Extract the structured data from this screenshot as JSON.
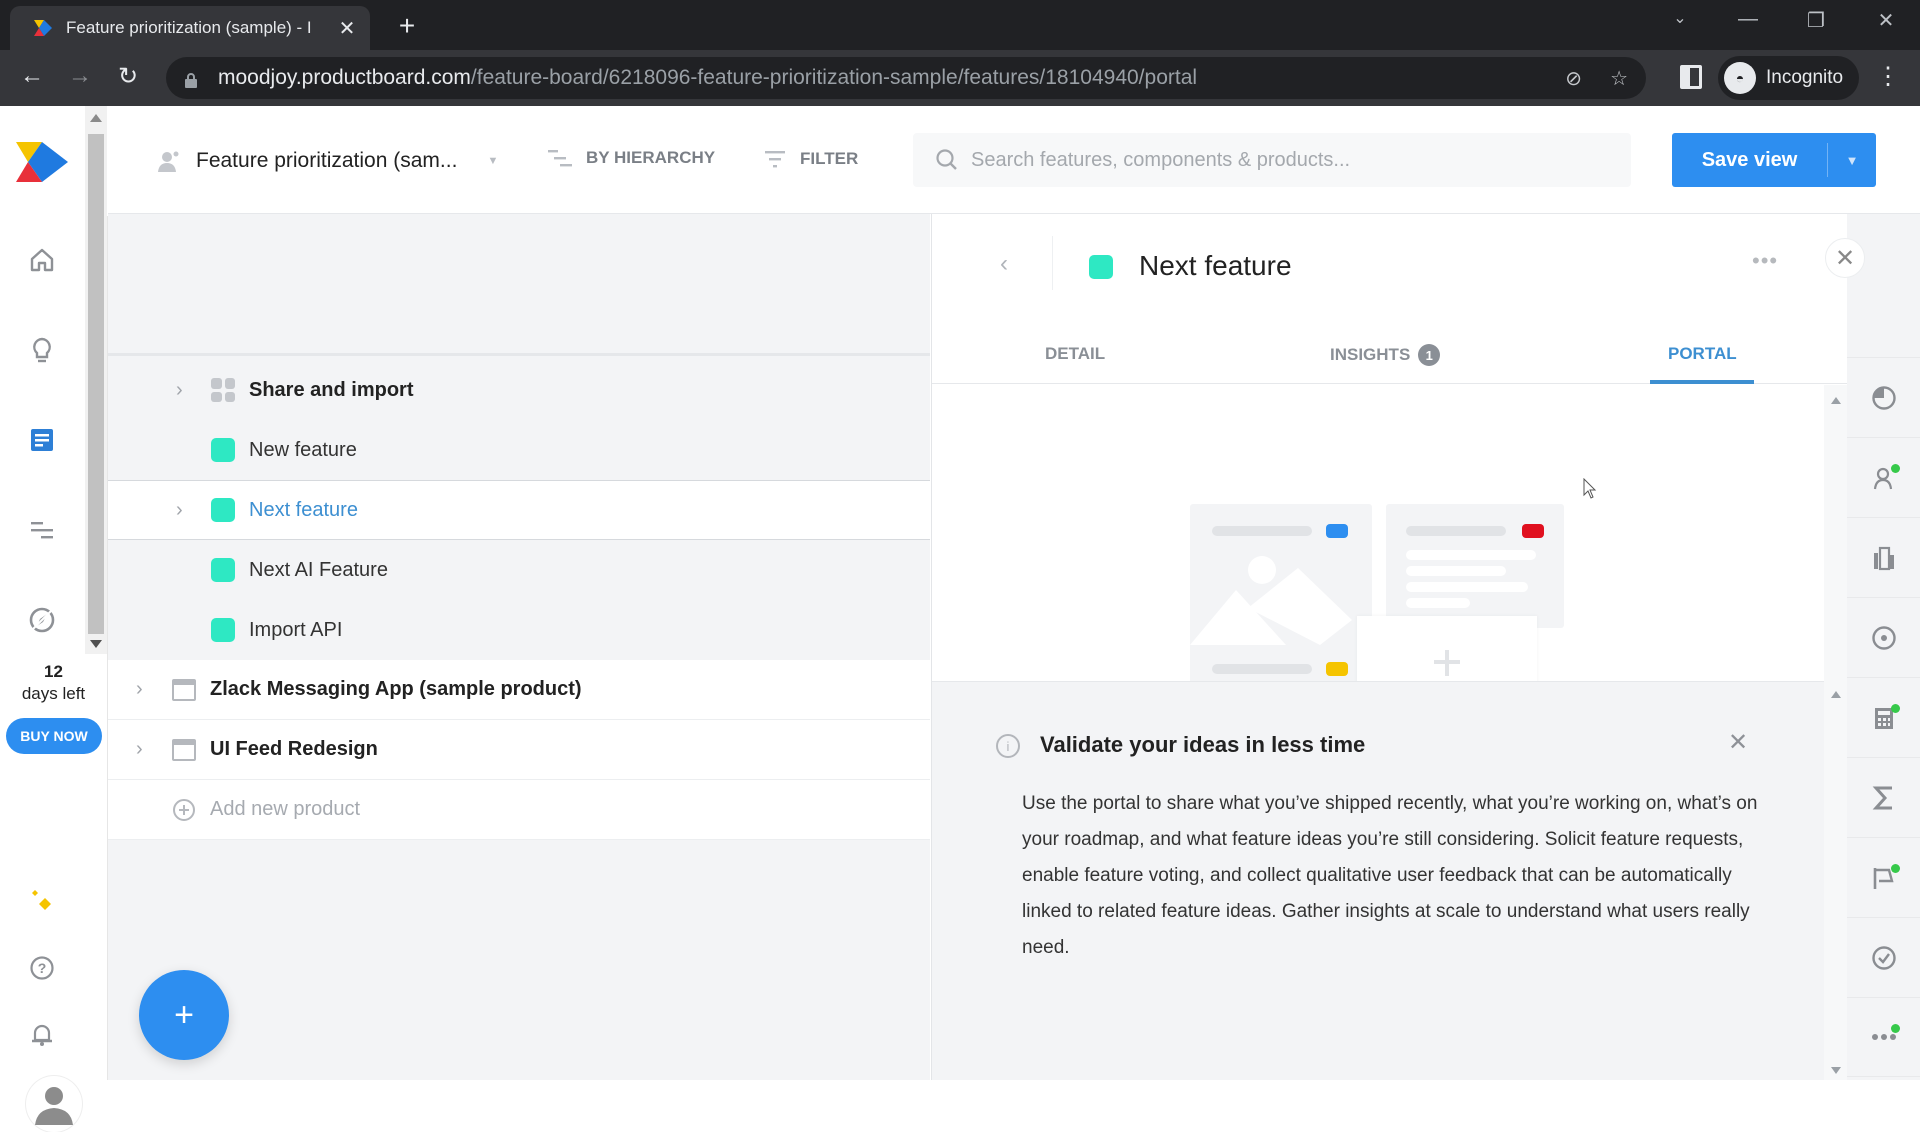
{
  "browser": {
    "tab_title": "Feature prioritization (sample) - I",
    "new_tab_icon": "plus-icon",
    "url_host": "moodjoy.productboard.com",
    "url_path": "/feature-board/6218096-feature-prioritization-sample/features/18104940/portal",
    "profile_label": "Incognito"
  },
  "left_nav": {
    "items": [
      {
        "name": "home",
        "icon": "home-icon"
      },
      {
        "name": "insights",
        "icon": "lightbulb-icon"
      },
      {
        "name": "features",
        "icon": "board-icon",
        "active": true
      },
      {
        "name": "roadmap",
        "icon": "roadmap-icon"
      },
      {
        "name": "portal",
        "icon": "compass-icon"
      }
    ],
    "trial": {
      "days": "12",
      "label": "days left"
    },
    "buy_now": "BUY NOW",
    "bottom_items": [
      "sparkle-icon",
      "help-icon",
      "bell-icon",
      "avatar"
    ]
  },
  "header": {
    "board_name": "Feature prioritization (sam...",
    "group_by": "BY HIERARCHY",
    "filter": "FILTER",
    "search_placeholder": "Search features, components & products...",
    "save_view": "Save view"
  },
  "tree": {
    "rows": [
      {
        "type": "component",
        "label": "Share and import",
        "expandable": true
      },
      {
        "type": "feature",
        "label": "New feature",
        "expandable": false
      },
      {
        "type": "feature",
        "label": "Next feature",
        "expandable": true,
        "selected": true
      },
      {
        "type": "feature",
        "label": "Next AI Feature",
        "expandable": false
      },
      {
        "type": "feature",
        "label": "Import API",
        "expandable": false
      },
      {
        "type": "product",
        "label": "Zlack Messaging App (sample product)",
        "expandable": true
      },
      {
        "type": "product",
        "label": "UI Feed Redesign",
        "expandable": true
      }
    ],
    "add_product": "Add new product",
    "feature_color": "#2ee8c3"
  },
  "detail": {
    "title": "Next feature",
    "status_color": "#2ee8c3",
    "tabs": [
      {
        "label": "DETAIL"
      },
      {
        "label": "INSIGHTS",
        "badge": "1"
      },
      {
        "label": "PORTAL",
        "active": true
      }
    ],
    "info": {
      "title": "Validate your ideas in less time",
      "body": "Use the portal to share what you’ve shipped recently, what you’re working on, what’s on your roadmap, and what feature ideas you’re still considering. Solicit feature requests, enable feature voting, and collect qualitative user feedback that can be automatically linked to related feature ideas. Gather insights at scale to understand what users really need."
    }
  },
  "right_bar": {
    "items": [
      {
        "icon": "pie-chart-icon",
        "dot": false
      },
      {
        "icon": "user-icon",
        "dot": true
      },
      {
        "icon": "building-icon",
        "dot": false
      },
      {
        "icon": "target-icon",
        "dot": false
      },
      {
        "icon": "calculator-icon",
        "dot": true
      },
      {
        "icon": "sigma-icon",
        "dot": false
      },
      {
        "icon": "flag-icon",
        "dot": true
      },
      {
        "icon": "check-circle-icon",
        "dot": false
      },
      {
        "icon": "more-icon",
        "dot": true
      }
    ]
  },
  "colors": {
    "accent": "#2d8ef0",
    "active_text": "#3d8fd1",
    "feature": "#2ee8c3",
    "notification_dot": "#36c94a"
  }
}
